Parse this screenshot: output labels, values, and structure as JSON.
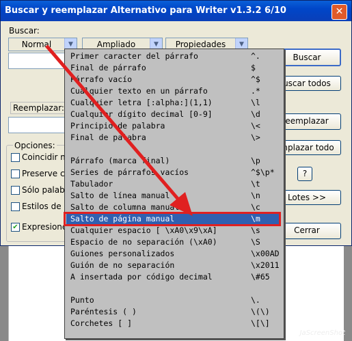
{
  "window": {
    "title": "Buscar y reemplazar Alternativo para Writer v1.3.2  6/10",
    "close": "✕"
  },
  "buscar": {
    "label": "Buscar:",
    "value": ""
  },
  "combos": {
    "normal": "Normal",
    "ampliado": "Ampliado",
    "propiedades": "Propiedades"
  },
  "reemplazar": {
    "label": "Reemplazar:",
    "value": ""
  },
  "opciones": {
    "label": "Opciones:",
    "items": [
      "Coincidir m",
      "Preserve c",
      "Sólo palab",
      "Estilos de p",
      "Expresione"
    ],
    "checked": [
      false,
      false,
      false,
      false,
      true
    ]
  },
  "buttons": {
    "buscar": "Buscar",
    "buscar_todos": "uscar todos",
    "reemplazar": "eemplazar",
    "reemplazar_todo": "mplazar todo",
    "help": "?",
    "lotes": "Lotes >>",
    "cerrar": "Cerrar"
  },
  "menu": {
    "selected_index": 14,
    "items": [
      {
        "l": "Primer caracter del párrafo",
        "r": "^."
      },
      {
        "l": "Final de párrafo",
        "r": "$"
      },
      {
        "l": "Párrafo vacío",
        "r": "^$"
      },
      {
        "l": "Cualquier texto en un párrafo",
        "r": ".*"
      },
      {
        "l": "Cualquier letra  [:alpha:](1,1)",
        "r": "\\l"
      },
      {
        "l": "Cualquier dígito decimal  [0-9]",
        "r": "\\d"
      },
      {
        "l": "Principio de palabra",
        "r": "\\<"
      },
      {
        "l": "Final de palabra",
        "r": "\\>"
      },
      {
        "l": "",
        "r": ""
      },
      {
        "l": "Párrafo (marca final)",
        "r": "\\p"
      },
      {
        "l": "Series de párrafos vacíos",
        "r": "^$\\p*"
      },
      {
        "l": "Tabulador",
        "r": "\\t"
      },
      {
        "l": "Salto de línea manual",
        "r": "\\n"
      },
      {
        "l": "Salto de columna manual",
        "r": "\\c"
      },
      {
        "l": "Salto de página manual",
        "r": "\\m"
      },
      {
        "l": "Cualquier espacio [ \\xA0\\x9\\xA]",
        "r": "\\s"
      },
      {
        "l": "Espacio de no separación (\\xA0)",
        "r": "\\S"
      },
      {
        "l": "Guiones personalizados",
        "r": "\\x00AD"
      },
      {
        "l": "Guión de no separación",
        "r": "\\x2011"
      },
      {
        "l": "A insertada por código decimal",
        "r": "\\#65"
      },
      {
        "l": "",
        "r": ""
      },
      {
        "l": "Punto",
        "r": "\\."
      },
      {
        "l": "Paréntesis  ( )",
        "r": "\\(\\)"
      },
      {
        "l": "Corchetes   [ ]",
        "r": "\\[\\]"
      }
    ]
  },
  "watermark": "JaScreenShot",
  "colors": {
    "highlight_box": "#e02020",
    "arrow": "#e02020",
    "menu_selection": "#3060b0"
  }
}
